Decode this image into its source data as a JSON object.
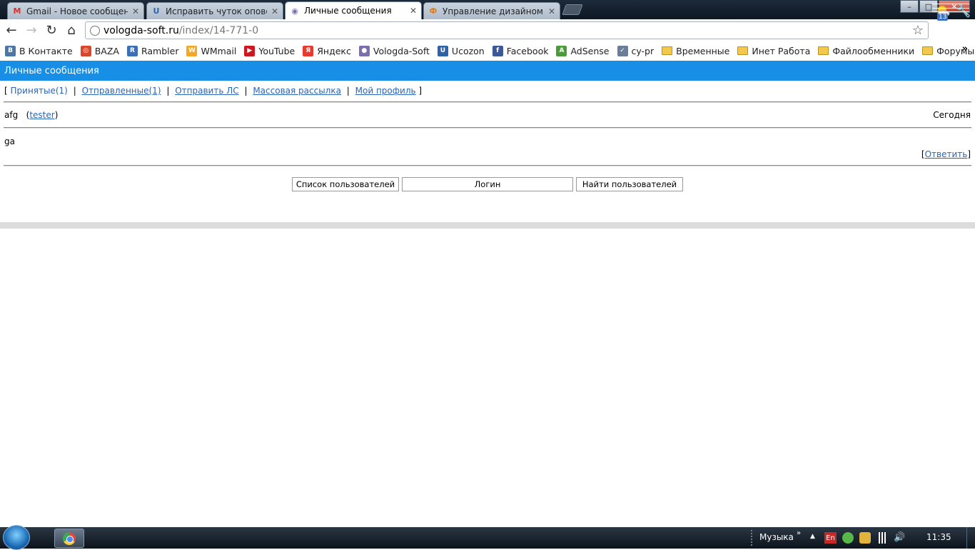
{
  "browser": {
    "tabs": [
      {
        "title": "Gmail - Новое сообщение",
        "icon": "gmail-icon",
        "active": false
      },
      {
        "title": "Исправить чуток оповеще",
        "icon": "ucoz-icon",
        "active": false
      },
      {
        "title": "Личные сообщения",
        "icon": "site-favicon",
        "active": true
      },
      {
        "title": "Управление дизайном - П",
        "icon": "ucoz-admin-icon",
        "active": false
      }
    ],
    "window_controls": {
      "minimize": "–",
      "maximize": "□",
      "close": "✕"
    },
    "address": {
      "host": "vologda-soft.ru",
      "path": "/index/14-771-0"
    },
    "extension_badge": "13",
    "bookmarks": [
      {
        "label": "В Контакте",
        "icon": "vk-icon",
        "color": "#4a76a8",
        "glyph": "B"
      },
      {
        "label": "BAZA",
        "icon": "baza-icon",
        "color": "#d9472b",
        "glyph": "◎"
      },
      {
        "label": "Rambler",
        "icon": "rambler-icon",
        "color": "#3b6fb6",
        "glyph": "R"
      },
      {
        "label": "WMmail",
        "icon": "wmmail-icon",
        "color": "#f5a623",
        "glyph": "W"
      },
      {
        "label": "YouTube",
        "icon": "youtube-icon",
        "color": "#cc181e",
        "glyph": "▶"
      },
      {
        "label": "Яндекс",
        "icon": "yandex-icon",
        "color": "#e63b2e",
        "glyph": "Я"
      },
      {
        "label": "Vologda-Soft",
        "icon": "vologda-soft-icon",
        "color": "#7b6fb0",
        "glyph": "●"
      },
      {
        "label": "Ucozon",
        "icon": "ucozon-icon",
        "color": "#2f63a8",
        "glyph": "U"
      },
      {
        "label": "Facebook",
        "icon": "facebook-icon",
        "color": "#3b5998",
        "glyph": "f"
      },
      {
        "label": "AdSense",
        "icon": "adsense-icon",
        "color": "#4a9c3a",
        "glyph": "A"
      },
      {
        "label": "cy-pr",
        "icon": "cy-pr-icon",
        "color": "#6a7d99",
        "glyph": "✓"
      }
    ],
    "bookmark_folders": [
      "Временные",
      "Инет Работа",
      "Файлообменники",
      "Форумы"
    ],
    "bookmarks_more": "»"
  },
  "page": {
    "header_title": "Личные сообщения",
    "nav": {
      "open_bracket": "[",
      "close_bracket": "]",
      "separator": "|",
      "inbox": "Принятые(1)",
      "sent": "Отправленные(1)",
      "send": "Отправить ЛС",
      "mass": "Массовая рассылка",
      "profile": "Мой профиль"
    },
    "message": {
      "subject": "afg",
      "sender": "tester",
      "date": "Сегодня",
      "body": "ga",
      "reply": "Ответить"
    },
    "buttons": {
      "user_list": "Список пользователей",
      "login": "Логин",
      "find_users": "Найти пользователей"
    }
  },
  "taskbar": {
    "tray_label": "Музыка",
    "tray_chevron": "»",
    "language": "En",
    "clock": "11:35"
  },
  "colors": {
    "header_bg": "#178fe6",
    "link": "#2a64b5"
  }
}
